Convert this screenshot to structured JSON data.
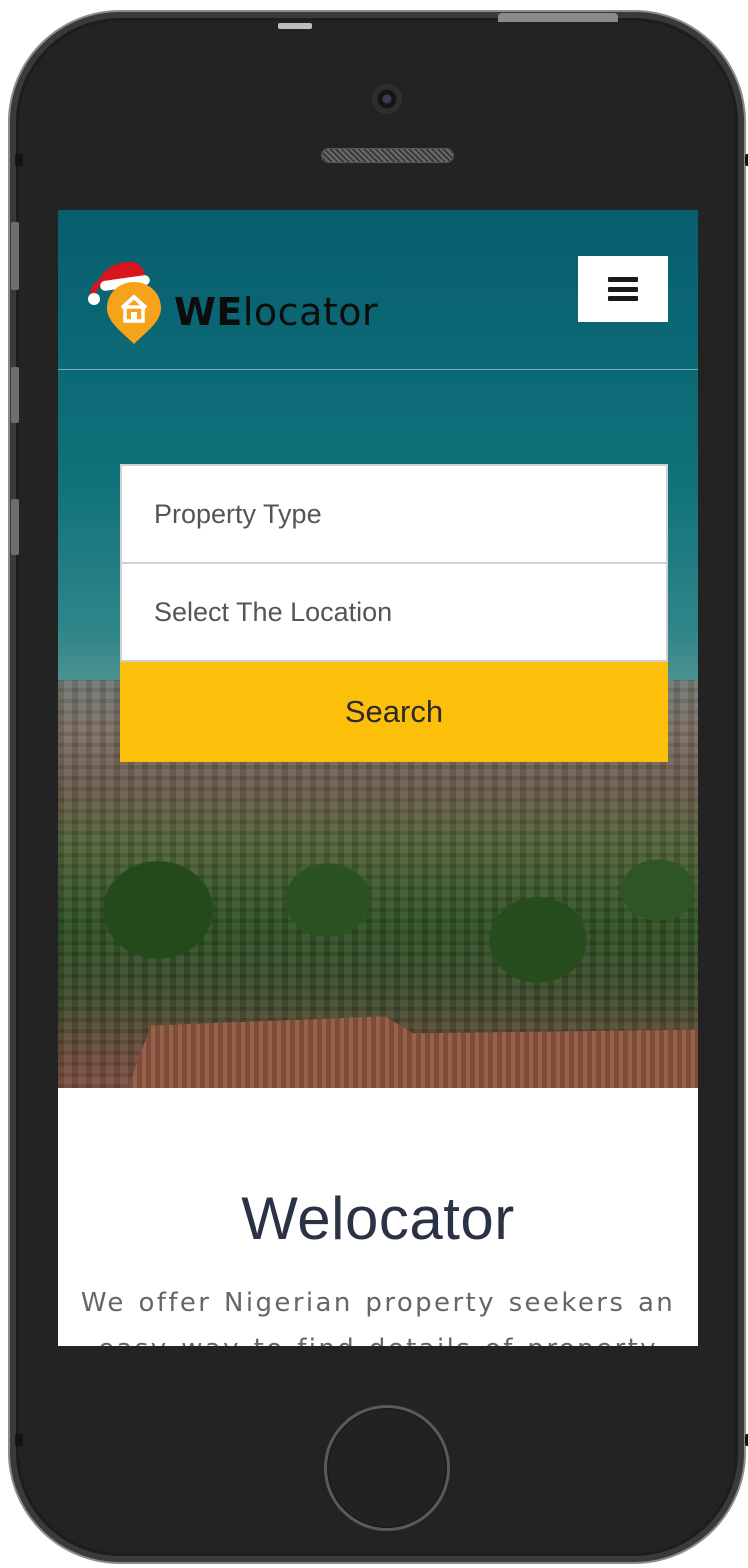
{
  "header": {
    "brand_bold": "WE",
    "brand_rest": "locator",
    "menu_icon": "hamburger-icon"
  },
  "search": {
    "property_type": "Property Type",
    "location": "Select The Location",
    "search_label": "Search"
  },
  "about": {
    "title": "Welocator",
    "text": "We offer Nigerian property seekers an easy way to find details of property"
  },
  "colors": {
    "accent": "#fcbf0a",
    "logo_pin": "#f7a21b",
    "hero_top": "#075e6e",
    "title": "#2c3245"
  }
}
